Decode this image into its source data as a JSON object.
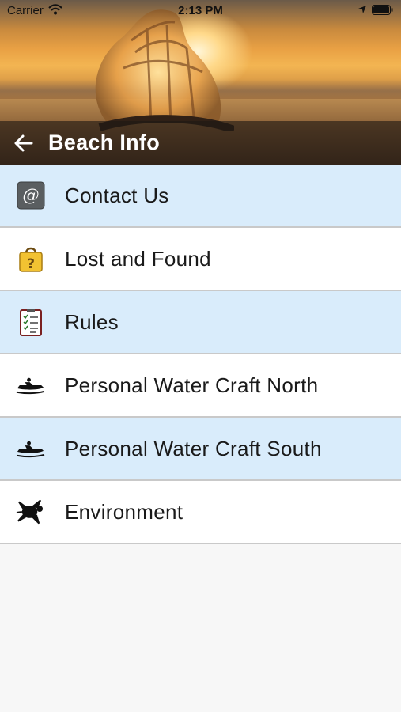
{
  "status_bar": {
    "carrier": "Carrier",
    "time": "2:13 PM"
  },
  "header": {
    "title": "Beach Info",
    "back_icon": "arrow-left-icon"
  },
  "menu": [
    {
      "label": "Contact Us",
      "icon": "at-sign-icon",
      "highlighted": true
    },
    {
      "label": "Lost and Found",
      "icon": "lost-found-bag-icon",
      "highlighted": false
    },
    {
      "label": "Rules",
      "icon": "clipboard-checklist-icon",
      "highlighted": true
    },
    {
      "label": "Personal Water Craft North",
      "icon": "jet-ski-icon",
      "highlighted": false
    },
    {
      "label": "Personal Water Craft South",
      "icon": "jet-ski-icon",
      "highlighted": true
    },
    {
      "label": "Environment",
      "icon": "sea-turtle-icon",
      "highlighted": false
    }
  ],
  "colors": {
    "row_highlight": "#d9ecfb",
    "row_plain": "#ffffff",
    "divider": "#c9c9c9",
    "background": "#f7f7f7"
  }
}
